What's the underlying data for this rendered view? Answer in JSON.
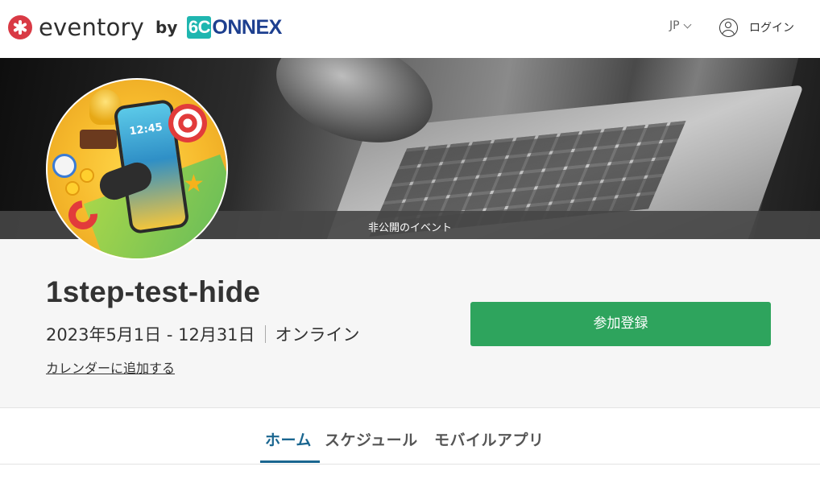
{
  "header": {
    "brand": {
      "name": "eventory",
      "by": "by",
      "partner_mark": "6C",
      "partner_rest": "ONNEX"
    },
    "language": "JP",
    "login": "ログイン"
  },
  "banner": {
    "private_label": "非公開のイベント"
  },
  "event": {
    "title": "1step-test-hide",
    "dates": "2023年5月1日 - 12月31日",
    "location": "オンライン",
    "add_to_calendar": "カレンダーに追加する",
    "register_button": "参加登録"
  },
  "tabs": [
    {
      "label": "ホーム",
      "active": true
    },
    {
      "label": "スケジュール",
      "active": false
    },
    {
      "label": "モバイルアプリ",
      "active": false
    }
  ],
  "avatar": {
    "time": "12:45"
  },
  "colors": {
    "brand_red": "#d93a45",
    "connex_blue": "#1d3f8f",
    "connex_teal": "#1fb6b0",
    "register_green": "#2ea45d",
    "active_tab": "#1a6690"
  },
  "icons": {
    "brand": "eventory-logo-icon",
    "language_caret": "chevron-down-icon",
    "user": "user-circle-icon"
  }
}
